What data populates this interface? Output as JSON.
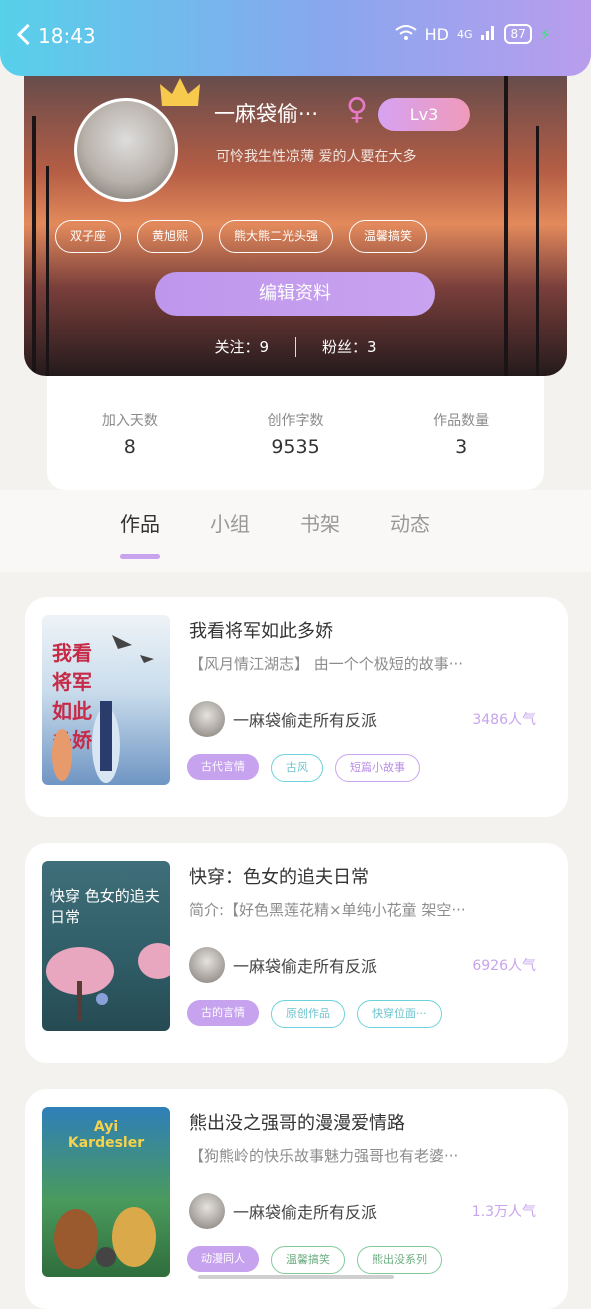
{
  "status_bar": {
    "time": "18:43",
    "network": "HD",
    "signal": "4G",
    "battery": "87"
  },
  "profile": {
    "nickname": "一麻袋偷···",
    "gender_symbol": "♀",
    "level": "Lv3",
    "signature": "可怜我生性凉薄 爱的人要在大多",
    "tags": [
      "双子座",
      "黄旭熙",
      "熊大熊二光头强",
      "温馨搞笑"
    ],
    "edit_label": "编辑资料",
    "follow_text": "关注：9",
    "fans_text": "粉丝：3"
  },
  "stats": [
    {
      "label": "加入天数",
      "value": "8"
    },
    {
      "label": "创作字数",
      "value": "9535"
    },
    {
      "label": "作品数量",
      "value": "3"
    }
  ],
  "tabs": [
    "作品",
    "小组",
    "书架",
    "动态"
  ],
  "books": [
    {
      "title": "我看将军如此多娇",
      "desc": "【风月情江湖志】 由一个个极短的故事···",
      "author": "一麻袋偷走所有反派",
      "popularity": "3486人气",
      "cover_text": "我看将军如此多娇",
      "tags": [
        "古代言情",
        "古风",
        "短篇小故事"
      ]
    },
    {
      "title": "快穿：色女的追夫日常",
      "desc": "简介:【好色黑莲花精×单纯小花童 架空···",
      "author": "一麻袋偷走所有反派",
      "popularity": "6926人气",
      "cover_text": "快穿 色女的追夫日常",
      "tags": [
        "古的言情",
        "原创作品",
        "快穿位面···"
      ]
    },
    {
      "title": "熊出没之强哥的漫漫爱情路",
      "desc": "【狗熊岭的快乐故事魅力强哥也有老婆···",
      "author": "一麻袋偷走所有反派",
      "popularity": "1.3万人气",
      "cover_text": "Ayi Kardesler",
      "tags": [
        "动漫同人",
        "温馨搞笑",
        "熊出没系列"
      ]
    }
  ]
}
